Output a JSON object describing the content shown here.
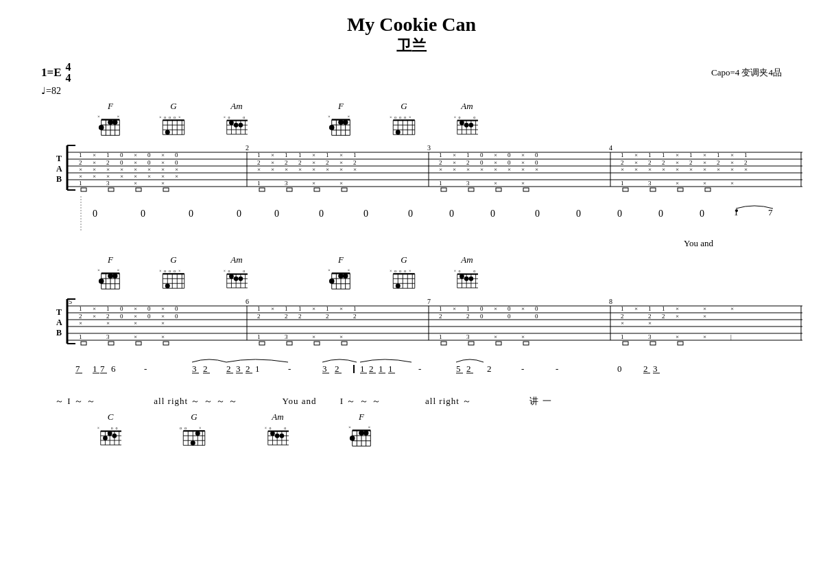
{
  "title": {
    "main": "My Cookie Can",
    "sub": "卫兰"
  },
  "header": {
    "key": "1=E",
    "time_num": "4",
    "time_den": "4",
    "tempo": "♩=82",
    "capo": "Capo=4  变调夹4品"
  },
  "chords_row1": [
    {
      "name": "F",
      "markers": "× ×",
      "fret_marker": ""
    },
    {
      "name": "G",
      "markers": "×ooo×",
      "fret_marker": ""
    },
    {
      "name": "Am",
      "markers": "×o  o",
      "fret_marker": ""
    },
    {
      "name": "F",
      "markers": "× ×",
      "fret_marker": ""
    },
    {
      "name": "G",
      "markers": "×ooo×",
      "fret_marker": ""
    },
    {
      "name": "Am",
      "markers": "×o  o",
      "fret_marker": ""
    }
  ],
  "bar_numbers_row1": [
    "2",
    "3",
    "4"
  ],
  "tab_notes_row1": "TAB staff line 1",
  "melody_row1": [
    "0",
    "0",
    "0",
    "0",
    "0",
    "0",
    "0",
    "0",
    "0",
    "0",
    "0",
    "0",
    "0",
    "0",
    "0",
    "1̇",
    "7"
  ],
  "lyrics_row1": "You and",
  "chords_row2": [
    {
      "name": "F",
      "markers": "× ×"
    },
    {
      "name": "G",
      "markers": "×ooo×"
    },
    {
      "name": "Am",
      "markers": "×o  o"
    },
    {
      "name": "F",
      "markers": "× ×"
    },
    {
      "name": "G",
      "markers": "×ooo×"
    },
    {
      "name": "Am",
      "markers": "×o  o"
    }
  ],
  "bar_numbers_row2": [
    "5",
    "6",
    "7",
    "8"
  ],
  "melody_row2": [
    "7̱",
    "17̱6",
    "-",
    "3̣2̤",
    "2̣3̣2̣1",
    "-",
    "3̣2̤",
    "1̣2̣1̣1̤",
    "-",
    "5̣2̤",
    "2",
    "-",
    "02̣3̣"
  ],
  "lyrics_row2": "～ I ～ ～          all right  ～ ～ ～～       You and   I ～ ～ ～       all right  ～           讲 一",
  "chords_row3": [
    {
      "name": "C",
      "markers": "×  oo"
    },
    {
      "name": "G",
      "markers": "oo×"
    },
    {
      "name": "Am",
      "markers": "×o  o"
    },
    {
      "name": "F",
      "markers": "× ×"
    }
  ]
}
